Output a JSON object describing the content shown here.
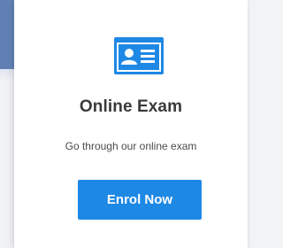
{
  "card": {
    "icon": "id-card-icon",
    "title": "Online Exam",
    "description": "Go through our online exam",
    "button_label": "Enrol Now"
  },
  "colors": {
    "accent": "#1e88e5",
    "title_text": "#3a3a3a",
    "background_band": "#7f9ac6"
  }
}
